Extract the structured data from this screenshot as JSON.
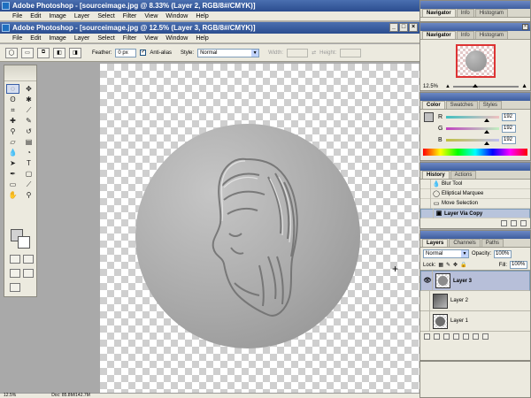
{
  "windows": [
    {
      "title": "Adobe Photoshop - [sourceimage.jpg @ 8.33% (Layer 2, RGB/8#/CMYK)]"
    },
    {
      "title": "Adobe Photoshop - [sourceimage.jpg @ 12.5% (Layer 3, RGB/8#/CMYK)]"
    }
  ],
  "menu": [
    "File",
    "Edit",
    "Image",
    "Layer",
    "Select",
    "Filter",
    "View",
    "Window",
    "Help"
  ],
  "options": {
    "feather_label": "Feather:",
    "feather_value": "0 px",
    "antialias_label": "Anti-alias",
    "antialias_checked": true,
    "style_label": "Style:",
    "style_value": "Normal",
    "width_label": "Width:",
    "height_label": "Height:"
  },
  "status": {
    "zoom": "12.5%",
    "doc": "Doc: 85.8M/142.7M"
  },
  "navigator": {
    "tabs": [
      "Navigator",
      "Info",
      "Histogram"
    ],
    "zoom": "12.5%"
  },
  "color": {
    "tabs": [
      "Color",
      "Swatches",
      "Styles"
    ],
    "channels": [
      {
        "label": "R",
        "value": "192",
        "color": "#d43a3a"
      },
      {
        "label": "G",
        "value": "192",
        "color": "#37b437"
      },
      {
        "label": "B",
        "value": "192",
        "color": "#3a3ad4"
      }
    ]
  },
  "history": {
    "tabs": [
      "History",
      "Actions"
    ],
    "items": [
      {
        "label": "Blur Tool",
        "icon": "blur-tool-icon",
        "selected": false
      },
      {
        "label": "Elliptical Marquee",
        "icon": "ellipse-marquee-icon",
        "selected": false
      },
      {
        "label": "Move Selection",
        "icon": "move-icon",
        "selected": false
      },
      {
        "label": "Layer Via Copy",
        "icon": "layer-icon",
        "selected": true
      }
    ]
  },
  "layers": {
    "tabs": [
      "Layers",
      "Channels",
      "Paths"
    ],
    "blend_mode": "Normal",
    "opacity_label": "Opacity:",
    "opacity": "100%",
    "lock_label": "Lock:",
    "fill_label": "Fill:",
    "fill": "100%",
    "items": [
      {
        "name": "Layer 3",
        "selected": true,
        "visible": true
      },
      {
        "name": "Layer 2",
        "selected": false,
        "visible": false
      },
      {
        "name": "Layer 1",
        "selected": false,
        "visible": false
      }
    ]
  }
}
